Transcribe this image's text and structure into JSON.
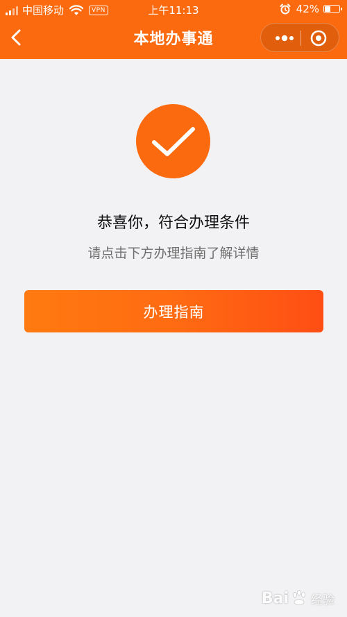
{
  "status_bar": {
    "carrier": "中国移动",
    "vpn_label": "VPN",
    "time": "上午11:13",
    "battery_percent": "42%",
    "battery_level": 0.42
  },
  "nav_bar": {
    "title": "本地办事通"
  },
  "result": {
    "headline": "恭喜你，符合办理条件",
    "subtext": "请点击下方办理指南了解详情"
  },
  "actions": {
    "guide_button_label": "办理指南"
  },
  "watermark": {
    "brand_part1": "Bai",
    "brand_part2": "经验"
  },
  "colors": {
    "accent": "#fb6a0e",
    "background": "#f2f1f3"
  },
  "icons": [
    "back-arrow-icon",
    "more-dots-icon",
    "close-circle-icon",
    "checkmark-icon",
    "wifi-icon",
    "alarm-icon",
    "paw-icon"
  ]
}
